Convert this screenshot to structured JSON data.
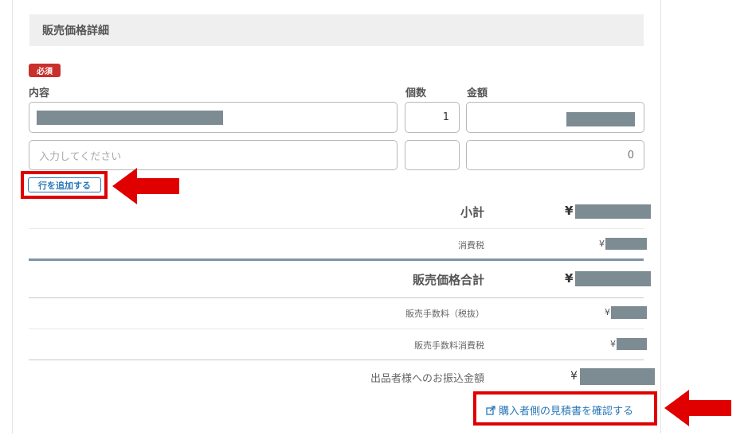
{
  "section": {
    "title": "販売価格詳細"
  },
  "required_badge": "必須",
  "columns": {
    "content": "内容",
    "quantity": "個数",
    "amount": "金額"
  },
  "rows": [
    {
      "quantity": "1"
    },
    {
      "content_placeholder": "入力してください",
      "quantity": "",
      "amount": "0"
    }
  ],
  "add_row_button": "行を追加する",
  "summary": {
    "subtotal_label": "小計",
    "tax_label": "消費税",
    "total_label": "販売価格合計",
    "fee_label": "販売手数料（税抜）",
    "fee_tax_label": "販売手数料消費税",
    "payout_label": "出品者様へのお振込金額",
    "currency": "¥"
  },
  "buyer_quote_link": "購入者側の見積書を確認する",
  "colors": {
    "highlight": "#e00000",
    "link": "#2a78b8",
    "mask": "#7d8b93",
    "badge": "#c9302c"
  }
}
